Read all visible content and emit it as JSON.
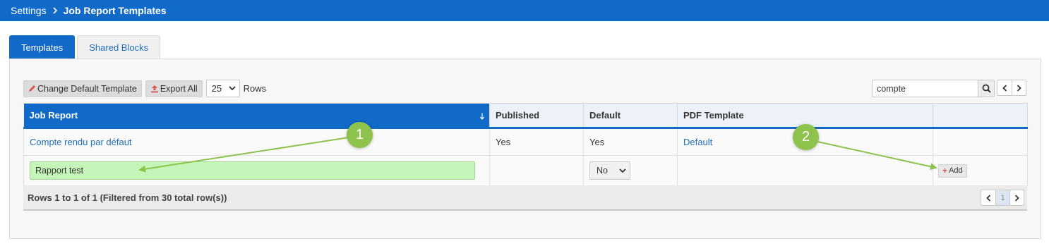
{
  "breadcrumb": {
    "root": "Settings",
    "current": "Job Report Templates"
  },
  "tabs": [
    {
      "label": "Templates",
      "active": true
    },
    {
      "label": "Shared Blocks",
      "active": false
    }
  ],
  "toolbar": {
    "change_default_label": "Change Default Template",
    "export_all_label": "Export All",
    "rows_per_page": "25",
    "rows_label": "Rows"
  },
  "search": {
    "value": "compte"
  },
  "table": {
    "columns": [
      "Job Report",
      "Published",
      "Default",
      "PDF Template",
      ""
    ],
    "sort_column": "Job Report",
    "rows": [
      {
        "job_report": "Compte rendu par défaut",
        "published": "Yes",
        "default": "Yes",
        "pdf_template": "Default"
      }
    ],
    "new_row": {
      "name_value": "Rapport test",
      "default_value": "No",
      "add_label": "Add"
    }
  },
  "footer": {
    "summary": "Rows 1 to 1 of 1 (Filtered from 30 total row(s))",
    "page": "1"
  },
  "callouts": [
    "1",
    "2"
  ],
  "colors": {
    "header_blue": "#1169c8",
    "callout_green": "#8dc24c",
    "input_green": "#c5f5b8",
    "link_blue": "#1f6fb7"
  }
}
